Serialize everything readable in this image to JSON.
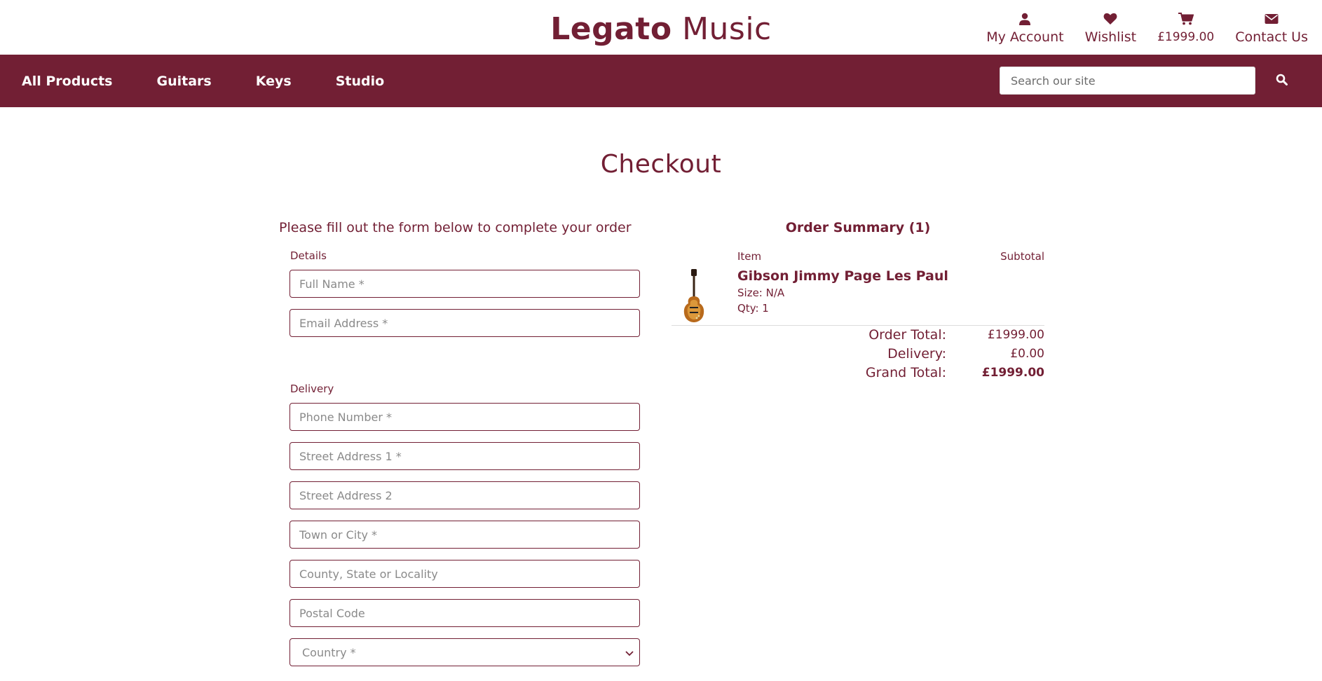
{
  "brand": {
    "bold": "Legato",
    "light": "Music"
  },
  "toplinks": [
    {
      "label": "My Account",
      "icon": "user-icon"
    },
    {
      "label": "Wishlist",
      "icon": "heart-icon"
    },
    {
      "label": "£1999.00",
      "icon": "cart-icon"
    },
    {
      "label": "Contact Us",
      "icon": "envelope-icon"
    }
  ],
  "nav": {
    "items": [
      "All Products",
      "Guitars",
      "Keys",
      "Studio"
    ],
    "search_placeholder": "Search our site",
    "search_icon": "search-icon"
  },
  "page": {
    "title": "Checkout"
  },
  "form": {
    "intro": "Please fill out the form below to complete your order",
    "details_label": "Details",
    "delivery_label": "Delivery",
    "fields": {
      "full_name": "Full Name *",
      "email": "Email Address *",
      "phone": "Phone Number *",
      "street1": "Street Address 1 *",
      "street2": "Street Address 2",
      "town": "Town or City *",
      "county": "County, State or Locality",
      "postcode": "Postal Code"
    },
    "country_select": "Country *"
  },
  "summary": {
    "title": "Order Summary (1)",
    "col_item": "Item",
    "col_subtotal": "Subtotal",
    "product": {
      "name": "Gibson Jimmy Page Les Paul",
      "size": "Size: N/A",
      "qty": "Qty: 1"
    },
    "totals": {
      "order_total_label": "Order Total:",
      "order_total_value": "£1999.00",
      "delivery_label": "Delivery:",
      "delivery_value": "£0.00",
      "grand_total_label": "Grand Total:",
      "grand_total_value": "£1999.00"
    }
  },
  "colors": {
    "brand": "#721f34",
    "white": "#ffffff",
    "placeholder": "#8a8a8a"
  }
}
